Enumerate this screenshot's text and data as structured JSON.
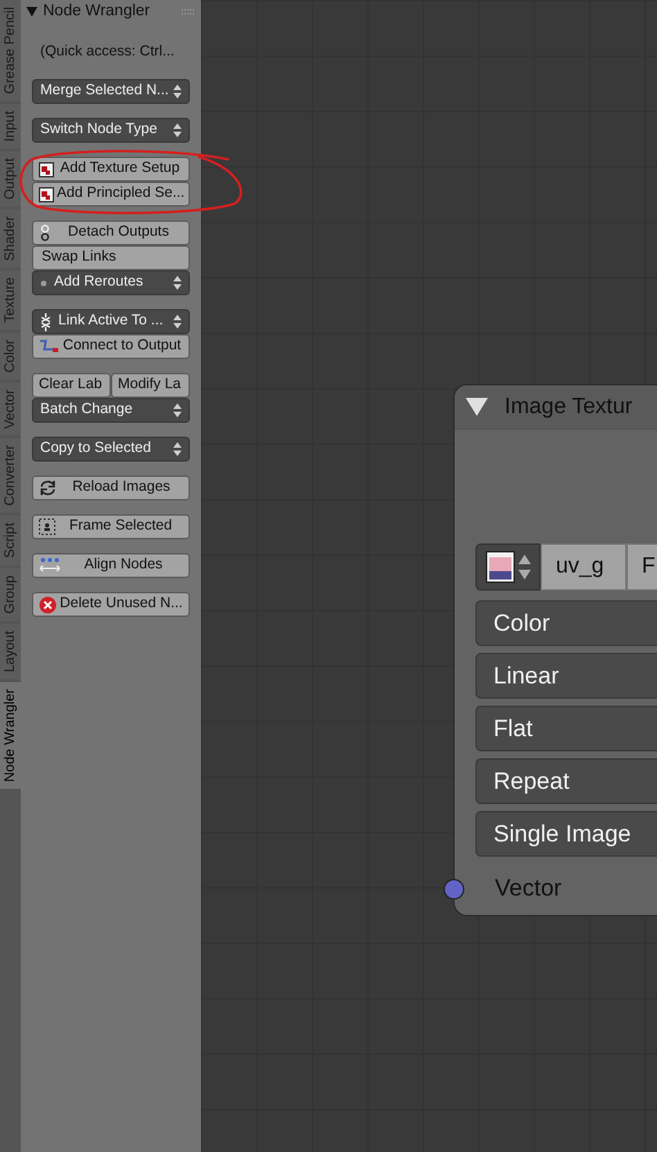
{
  "tabs": [
    {
      "label": "Grease Pencil",
      "selected": false
    },
    {
      "label": "Input",
      "selected": false
    },
    {
      "label": "Output",
      "selected": false
    },
    {
      "label": "Shader",
      "selected": false
    },
    {
      "label": "Texture",
      "selected": false
    },
    {
      "label": "Color",
      "selected": false
    },
    {
      "label": "Vector",
      "selected": false
    },
    {
      "label": "Converter",
      "selected": false
    },
    {
      "label": "Script",
      "selected": false
    },
    {
      "label": "Group",
      "selected": false
    },
    {
      "label": "Layout",
      "selected": false
    },
    {
      "label": "Node Wrangler",
      "selected": true
    }
  ],
  "panel": {
    "title": "Node Wrangler",
    "expanded": true,
    "groups": [
      {
        "items": [
          {
            "kind": "label",
            "text": "(Quick access: Ctrl..."
          }
        ]
      },
      {
        "items": [
          {
            "kind": "menu",
            "text": "Merge Selected N..."
          }
        ]
      },
      {
        "items": [
          {
            "kind": "menu",
            "text": "Switch Node Type"
          }
        ]
      },
      {
        "highlighted": true,
        "items": [
          {
            "kind": "button",
            "text": "Add Texture Setup"
          },
          {
            "kind": "button",
            "text": "Add Principled Se..."
          }
        ]
      },
      {
        "items": [
          {
            "kind": "button",
            "text": "Detach Outputs"
          },
          {
            "kind": "button",
            "text": "Swap Links"
          },
          {
            "kind": "menu",
            "text": "Add Reroutes"
          }
        ]
      },
      {
        "items": [
          {
            "kind": "menu",
            "text": "Link Active To ..."
          },
          {
            "kind": "button",
            "text": "Connect to Output"
          }
        ]
      },
      {
        "items": [
          {
            "kind": "row",
            "texts": [
              "Clear Lab",
              "Modify La"
            ]
          },
          {
            "kind": "menu",
            "text": "Batch Change"
          }
        ]
      },
      {
        "items": [
          {
            "kind": "menu",
            "text": "Copy to Selected"
          }
        ]
      },
      {
        "items": [
          {
            "kind": "button",
            "text": "Reload Images"
          }
        ]
      },
      {
        "items": [
          {
            "kind": "button",
            "text": "Frame Selected"
          }
        ]
      },
      {
        "items": [
          {
            "kind": "button",
            "text": "Align Nodes"
          }
        ]
      },
      {
        "items": [
          {
            "kind": "button",
            "text": "Delete Unused N..."
          }
        ]
      }
    ]
  },
  "node": {
    "title": "Image Textur",
    "expanded": true,
    "image_field": [
      "uv_g",
      "F"
    ],
    "dropdowns": [
      "Color",
      "Linear",
      "Flat",
      "Repeat",
      "Single Image"
    ],
    "sockets": [
      {
        "label": "Vector",
        "color": "#6363c7"
      }
    ]
  }
}
